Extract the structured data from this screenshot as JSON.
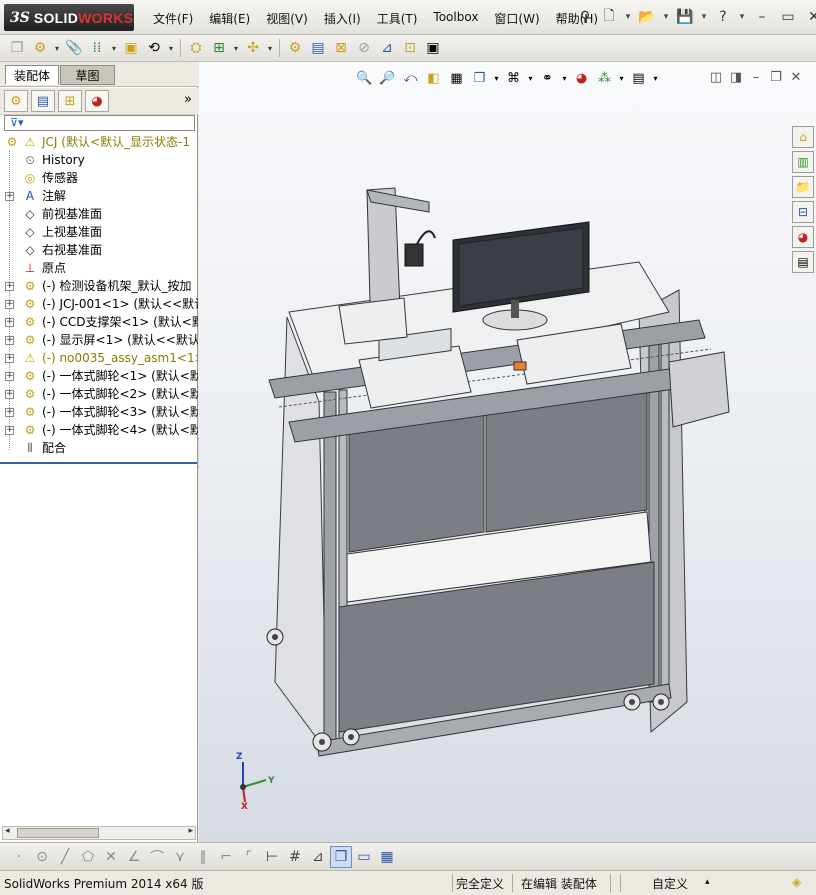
{
  "app": {
    "logo_ds": "3S",
    "logo_name_a": "SOLID",
    "logo_name_b": "WORKS"
  },
  "menu": [
    "文件(F)",
    "编辑(E)",
    "视图(V)",
    "插入(I)",
    "工具(T)",
    "Toolbox",
    "窗口(W)",
    "帮助(H)"
  ],
  "left_panel": {
    "tabs": {
      "assembly": "装配体",
      "sketch": "草图"
    },
    "more_glyph": "»",
    "filter_glyph": "⊽▾",
    "tree": [
      {
        "label": "JCJ  (默认<默认_显示状态-1",
        "icon": "assembly-icon",
        "expand": "",
        "style": "root"
      },
      {
        "label": "History",
        "icon": "history-icon",
        "expand": ""
      },
      {
        "label": "传感器",
        "icon": "sensor-icon",
        "expand": ""
      },
      {
        "label": "注解",
        "icon": "annotation-icon",
        "expand": "+"
      },
      {
        "label": "前视基准面",
        "icon": "plane-icon",
        "expand": ""
      },
      {
        "label": "上视基准面",
        "icon": "plane-icon",
        "expand": ""
      },
      {
        "label": "右视基准面",
        "icon": "plane-icon",
        "expand": ""
      },
      {
        "label": "原点",
        "icon": "origin-icon",
        "expand": ""
      },
      {
        "label": "(-) 检测设备机架_默认_按加",
        "icon": "part-icon",
        "expand": "+"
      },
      {
        "label": "(-) JCJ-001<1> (默认<<默认",
        "icon": "part-icon",
        "expand": "+"
      },
      {
        "label": "(-) CCD支撑架<1> (默认<默",
        "icon": "part-icon",
        "expand": "+"
      },
      {
        "label": "(-) 显示屏<1> (默认<<默认_",
        "icon": "part-icon",
        "expand": "+"
      },
      {
        "label": "(-) no0035_assy_asm1<1>",
        "icon": "warning-icon",
        "expand": "+",
        "style": "warn"
      },
      {
        "label": "(-) 一体式脚轮<1> (默认<默",
        "icon": "part-icon",
        "expand": "+"
      },
      {
        "label": "(-) 一体式脚轮<2> (默认<默",
        "icon": "part-icon",
        "expand": "+"
      },
      {
        "label": "(-) 一体式脚轮<3> (默认<默",
        "icon": "part-icon",
        "expand": "+"
      },
      {
        "label": "(-) 一体式脚轮<4> (默认<默",
        "icon": "part-icon",
        "expand": "+"
      },
      {
        "label": "配合",
        "icon": "mates-icon",
        "expand": ""
      }
    ]
  },
  "viewport": {
    "triad": {
      "z": "Z",
      "y": "Y",
      "x": "X"
    }
  },
  "status": {
    "product": "SolidWorks Premium 2014 x64 版",
    "definition": "完全定义",
    "mode": "在编辑 装配体",
    "units": "自定义",
    "units_caret": "▴"
  }
}
